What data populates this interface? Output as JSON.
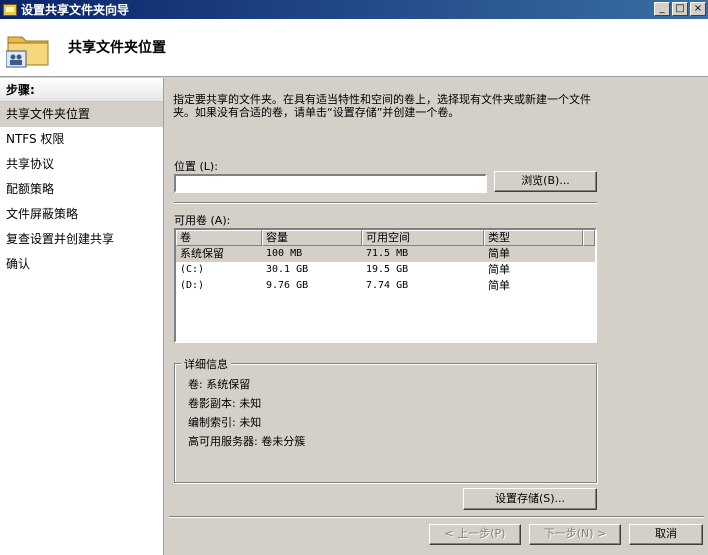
{
  "window": {
    "title": "设置共享文件夹向导",
    "controls": {
      "minimize": "_",
      "maximize": "□",
      "close": "×"
    }
  },
  "header": {
    "title": "共享文件夹位置",
    "icon": "folder-with-users-icon"
  },
  "sidebar": {
    "heading": "步骤:",
    "items": [
      {
        "label": "共享文件夹位置",
        "active": true
      },
      {
        "label": "NTFS 权限",
        "active": false
      },
      {
        "label": "共享协议",
        "active": false
      },
      {
        "label": "配额策略",
        "active": false
      },
      {
        "label": "文件屏蔽策略",
        "active": false
      },
      {
        "label": "复查设置并创建共享",
        "active": false
      },
      {
        "label": "确认",
        "active": false
      }
    ]
  },
  "main": {
    "instructions": "指定要共享的文件夹。在具有适当特性和空间的卷上，选择现有文件夹或新建一个文件夹。如果没有合适的卷，请单击“设置存储”并创建一个卷。",
    "location_label": "位置 (L):",
    "location_value": "",
    "browse_label": "浏览(B)...",
    "volumes_label": "可用卷 (A):",
    "volumes": {
      "columns": [
        "卷",
        "容量",
        "可用空间",
        "类型"
      ],
      "rows": [
        {
          "volume": "系统保留",
          "capacity": "100 MB",
          "free": "71.5 MB",
          "type": "简单",
          "selected": true
        },
        {
          "volume": "(C:)",
          "capacity": "30.1 GB",
          "free": "19.5 GB",
          "type": "简单",
          "selected": false
        },
        {
          "volume": "(D:)",
          "capacity": "9.76 GB",
          "free": "7.74 GB",
          "type": "简单",
          "selected": false
        }
      ]
    },
    "details": {
      "title": "详细信息",
      "volume": "卷:   系统保留",
      "shadow_copy": "卷影副本:   未知",
      "indexing": "编制索引:   未知",
      "ha_server": "高可用服务器:   卷未分簇"
    },
    "provision_storage_label": "设置存储(S)...",
    "nav": {
      "back_label": "< 上一步(P)",
      "next_label": "下一步(N) >",
      "cancel_label": "取消"
    }
  }
}
